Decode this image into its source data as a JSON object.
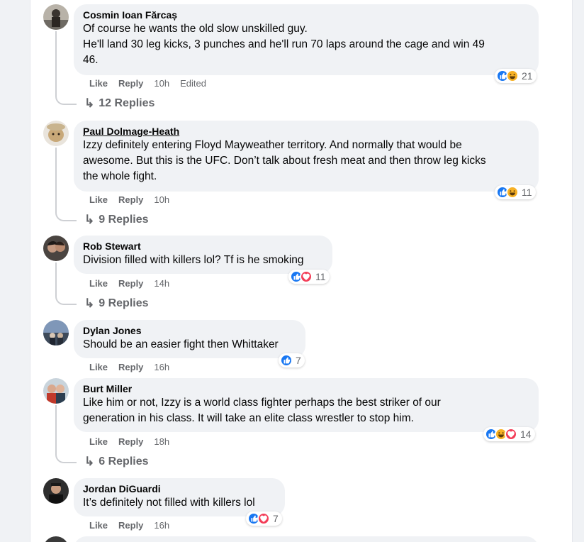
{
  "comments": [
    {
      "author": "Cosmin Ioan Fărcaș",
      "text": "Of course he wants the old slow unskilled guy.\nHe'll land 30 leg kicks, 3 punches and he'll run 70 laps around the cage and win 49\n46.",
      "like": "Like",
      "reply": "Reply",
      "time": "10h",
      "edited": "Edited",
      "reaction_count": "21",
      "reactions": [
        "like-icon",
        "haha-icon"
      ],
      "replies": "12 Replies"
    },
    {
      "author": "Paul Dolmage-Heath",
      "text": "Izzy definitely entering Floyd Mayweather territory. And normally that would be\nawesome. But this is the UFC. Don’t talk about fresh meat and then throw leg kicks\nthe whole fight.",
      "like": "Like",
      "reply": "Reply",
      "time": "10h",
      "reaction_count": "11",
      "reactions": [
        "like-icon",
        "haha-icon"
      ],
      "replies": "9 Replies"
    },
    {
      "author": "Rob Stewart",
      "text": "Division filled with killers lol? Tf is he smoking",
      "like": "Like",
      "reply": "Reply",
      "time": "14h",
      "reaction_count": "11",
      "reactions": [
        "like-icon",
        "love-icon"
      ],
      "replies": "9 Replies"
    },
    {
      "author": "Dylan Jones",
      "text": "Should be an easier fight then Whittaker",
      "like": "Like",
      "reply": "Reply",
      "time": "16h",
      "reaction_count": "7",
      "reactions": [
        "like-icon"
      ]
    },
    {
      "author": "Burt Miller",
      "text": "Like him or not, Izzy is a world class fighter perhaps the best striker of our\ngeneration in his class. It will take an elite class wrestler to stop him.",
      "like": "Like",
      "reply": "Reply",
      "time": "18h",
      "reaction_count": "14",
      "reactions": [
        "like-icon",
        "haha-icon",
        "love-icon"
      ],
      "replies": "6 Replies"
    },
    {
      "author": "Jordan DiGuardi",
      "text": "It’s definitely not filled with killers lol",
      "like": "Like",
      "reply": "Reply",
      "time": "16h",
      "reaction_count": "7",
      "reactions": [
        "like-icon",
        "love-icon"
      ]
    }
  ],
  "colors": {
    "bubble": "#f0f2f5",
    "like_blue": "#1877f2",
    "haha_yellow": "#f7b125",
    "love_red": "#f33e58",
    "meta_grey": "#65676b"
  }
}
